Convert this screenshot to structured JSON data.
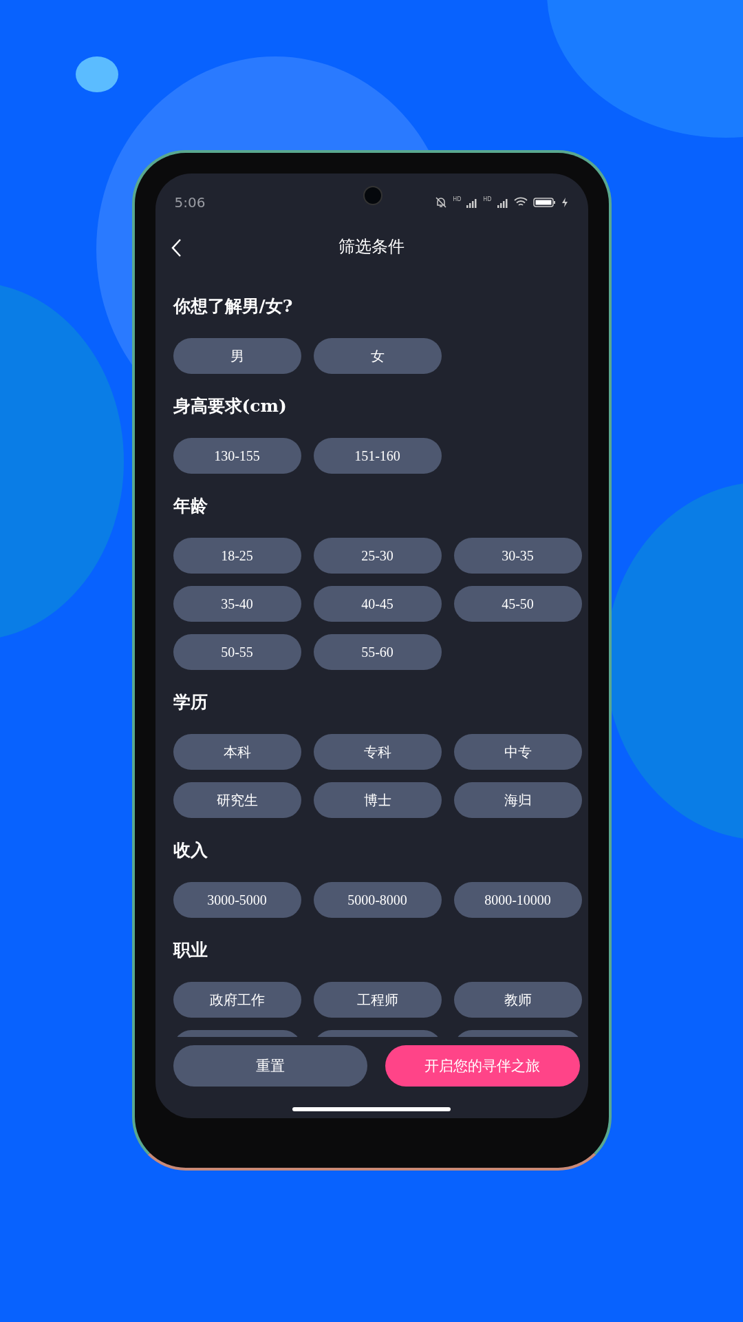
{
  "status_bar": {
    "time": "5:06",
    "network_labels": [
      "HD",
      "HD"
    ]
  },
  "header": {
    "title": "筛选条件"
  },
  "sections": [
    {
      "title": "你想了解男/女?",
      "options": [
        "男",
        "女"
      ]
    },
    {
      "title": "身高要求(cm)",
      "options": [
        "130-155",
        "151-160"
      ]
    },
    {
      "title": "年龄",
      "options": [
        "18-25",
        "25-30",
        "30-35",
        "35-40",
        "40-45",
        "45-50",
        "50-55",
        "55-60"
      ]
    },
    {
      "title": "学历",
      "options": [
        "本科",
        "专科",
        "中专",
        "研究生",
        "博士",
        "海归"
      ]
    },
    {
      "title": "收入",
      "options": [
        "3000-5000",
        "5000-8000",
        "8000-10000"
      ]
    },
    {
      "title": "职业",
      "options": [
        "政府工作",
        "工程师",
        "教师"
      ],
      "more_below": true
    }
  ],
  "footer": {
    "reset": "重置",
    "submit": "开启您的寻伴之旅"
  }
}
